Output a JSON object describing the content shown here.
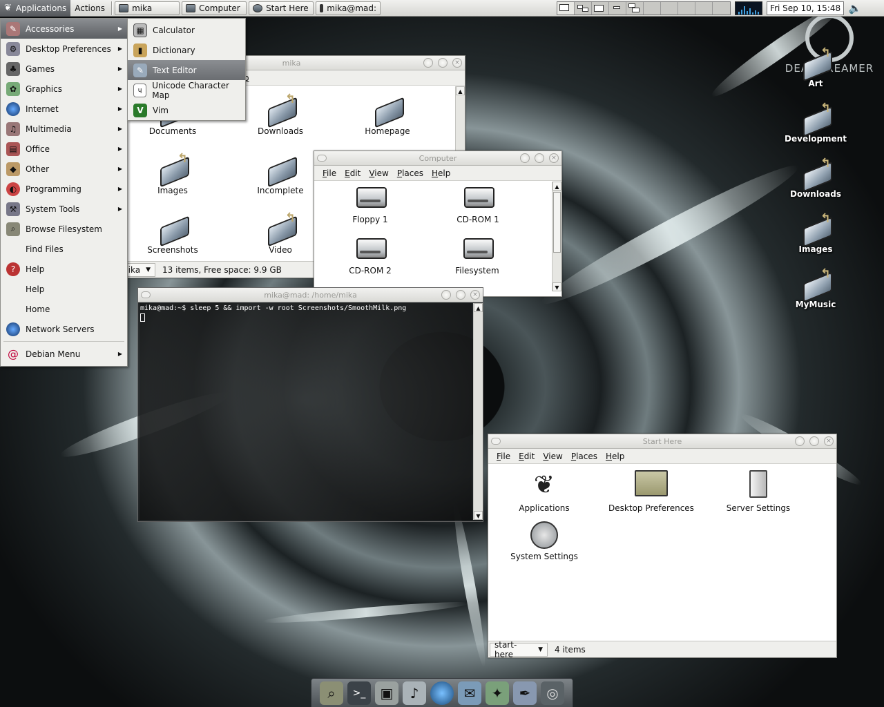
{
  "top_panel": {
    "applications": "Applications",
    "actions": "Actions",
    "tasks": [
      "mika",
      "Computer",
      "Start Here",
      "mika@mad:"
    ],
    "clock": "Fri Sep 10, 15:48"
  },
  "app_menu": {
    "items": [
      {
        "label": "Accessories",
        "icon": "accessories-icon",
        "submenu": true
      },
      {
        "label": "Desktop Preferences",
        "icon": "preferences-icon",
        "submenu": true
      },
      {
        "label": "Games",
        "icon": "games-icon",
        "submenu": true
      },
      {
        "label": "Graphics",
        "icon": "graphics-icon",
        "submenu": true
      },
      {
        "label": "Internet",
        "icon": "globe-icon",
        "submenu": true
      },
      {
        "label": "Multimedia",
        "icon": "multimedia-icon",
        "submenu": true
      },
      {
        "label": "Office",
        "icon": "office-icon",
        "submenu": true
      },
      {
        "label": "Other",
        "icon": "other-icon",
        "submenu": true
      },
      {
        "label": "Programming",
        "icon": "programming-icon",
        "submenu": true
      },
      {
        "label": "System Tools",
        "icon": "system-tools-icon",
        "submenu": true
      },
      {
        "label": "Browse Filesystem",
        "icon": "browse-icon",
        "submenu": false
      },
      {
        "label": "Find Files",
        "icon": "",
        "submenu": false
      },
      {
        "label": "Help",
        "icon": "help-icon",
        "submenu": false
      },
      {
        "label": "Help",
        "icon": "",
        "submenu": false
      },
      {
        "label": "Home",
        "icon": "",
        "submenu": false
      },
      {
        "label": "Network Servers",
        "icon": "globe-icon",
        "submenu": false
      }
    ],
    "debian": "Debian Menu"
  },
  "accessories_menu": {
    "items": [
      "Calculator",
      "Dictionary",
      "Text Editor",
      "Unicode Character Map",
      "Vim"
    ]
  },
  "mika_window": {
    "title": "mika",
    "menu_fragment": "p",
    "items": [
      "Documents",
      "Downloads",
      "Homepage",
      "Images",
      "Incomplete",
      "Screenshots",
      "Video"
    ],
    "status_combo": "mika",
    "status_text": "13 items, Free space: 9.9 GB"
  },
  "computer_window": {
    "title": "Computer",
    "menus": [
      "File",
      "Edit",
      "View",
      "Places",
      "Help"
    ],
    "items": [
      "Floppy 1",
      "CD-ROM 1",
      "CD-ROM 2",
      "Filesystem"
    ]
  },
  "terminal": {
    "title": "mika@mad: /home/mika",
    "line1": "mika@mad:~$ sleep 5 && import -w root Screenshots/SmoothMilk.png"
  },
  "start_here": {
    "title": "Start Here",
    "menus": [
      "File",
      "Edit",
      "View",
      "Places",
      "Help"
    ],
    "items": [
      "Applications",
      "Desktop Preferences",
      "Server Settings",
      "System Settings"
    ],
    "status_combo": "start-here",
    "status_text": "4 items"
  },
  "desktop_icons": [
    "Art",
    "Development",
    "Downloads",
    "Images",
    "MyMusic"
  ],
  "logo_text": "DEADDREAMER"
}
